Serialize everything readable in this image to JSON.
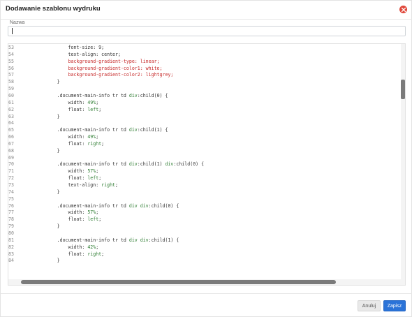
{
  "dialog": {
    "title": "Dodawanie szablonu wydruku",
    "close_icon": "close-icon",
    "close_color": "#e0473a"
  },
  "form": {
    "name_label": "Nazwa",
    "name_value": ""
  },
  "editor": {
    "lines": [
      {
        "n": "53",
        "segs": [
          {
            "t": "                font-size: 9;",
            "c": "plain"
          }
        ]
      },
      {
        "n": "54",
        "segs": [
          {
            "t": "                text-align: center;",
            "c": "plain"
          }
        ]
      },
      {
        "n": "55",
        "segs": [
          {
            "t": "                background-gradient-type: linear;",
            "c": "propc"
          }
        ]
      },
      {
        "n": "56",
        "segs": [
          {
            "t": "                background-gradient-color1: white;",
            "c": "propc"
          }
        ]
      },
      {
        "n": "57",
        "segs": [
          {
            "t": "                background-gradient-color2: lightgrey;",
            "c": "propc"
          }
        ]
      },
      {
        "n": "58",
        "segs": [
          {
            "t": "            }",
            "c": "plain"
          }
        ]
      },
      {
        "n": "59",
        "segs": [
          {
            "t": "",
            "c": "plain"
          }
        ]
      },
      {
        "n": "60",
        "segs": [
          {
            "t": "            .document-main-info tr td ",
            "c": "plain"
          },
          {
            "t": "div",
            "c": "val"
          },
          {
            "t": ":child(0) {",
            "c": "plain"
          }
        ]
      },
      {
        "n": "61",
        "segs": [
          {
            "t": "                width: ",
            "c": "plain"
          },
          {
            "t": "49%",
            "c": "val"
          },
          {
            "t": ";",
            "c": "plain"
          }
        ]
      },
      {
        "n": "62",
        "segs": [
          {
            "t": "                float: ",
            "c": "plain"
          },
          {
            "t": "left",
            "c": "val"
          },
          {
            "t": ";",
            "c": "plain"
          }
        ]
      },
      {
        "n": "63",
        "segs": [
          {
            "t": "            }",
            "c": "plain"
          }
        ]
      },
      {
        "n": "64",
        "segs": [
          {
            "t": "",
            "c": "plain"
          }
        ]
      },
      {
        "n": "65",
        "segs": [
          {
            "t": "            .document-main-info tr td ",
            "c": "plain"
          },
          {
            "t": "div",
            "c": "val"
          },
          {
            "t": ":child(1) {",
            "c": "plain"
          }
        ]
      },
      {
        "n": "66",
        "segs": [
          {
            "t": "                width: ",
            "c": "plain"
          },
          {
            "t": "49%",
            "c": "val"
          },
          {
            "t": ";",
            "c": "plain"
          }
        ]
      },
      {
        "n": "67",
        "segs": [
          {
            "t": "                float: ",
            "c": "plain"
          },
          {
            "t": "right",
            "c": "val"
          },
          {
            "t": ";",
            "c": "plain"
          }
        ]
      },
      {
        "n": "68",
        "segs": [
          {
            "t": "            }",
            "c": "plain"
          }
        ]
      },
      {
        "n": "69",
        "segs": [
          {
            "t": "",
            "c": "plain"
          }
        ]
      },
      {
        "n": "70",
        "segs": [
          {
            "t": "            .document-main-info tr td ",
            "c": "plain"
          },
          {
            "t": "div",
            "c": "val"
          },
          {
            "t": ":child(1) ",
            "c": "plain"
          },
          {
            "t": "div",
            "c": "val"
          },
          {
            "t": ":child(0) {",
            "c": "plain"
          }
        ]
      },
      {
        "n": "71",
        "segs": [
          {
            "t": "                width: ",
            "c": "plain"
          },
          {
            "t": "57%",
            "c": "val"
          },
          {
            "t": ";",
            "c": "plain"
          }
        ]
      },
      {
        "n": "72",
        "segs": [
          {
            "t": "                float: ",
            "c": "plain"
          },
          {
            "t": "left",
            "c": "val"
          },
          {
            "t": ";",
            "c": "plain"
          }
        ]
      },
      {
        "n": "73",
        "segs": [
          {
            "t": "                text-align: ",
            "c": "plain"
          },
          {
            "t": "right",
            "c": "val"
          },
          {
            "t": ";",
            "c": "plain"
          }
        ]
      },
      {
        "n": "74",
        "segs": [
          {
            "t": "            }",
            "c": "plain"
          }
        ]
      },
      {
        "n": "75",
        "segs": [
          {
            "t": "",
            "c": "plain"
          }
        ]
      },
      {
        "n": "76",
        "segs": [
          {
            "t": "            .document-main-info tr td ",
            "c": "plain"
          },
          {
            "t": "div div",
            "c": "val"
          },
          {
            "t": ":child(0) {",
            "c": "plain"
          }
        ]
      },
      {
        "n": "77",
        "segs": [
          {
            "t": "                width: ",
            "c": "plain"
          },
          {
            "t": "57%",
            "c": "val"
          },
          {
            "t": ";",
            "c": "plain"
          }
        ]
      },
      {
        "n": "78",
        "segs": [
          {
            "t": "                float: ",
            "c": "plain"
          },
          {
            "t": "left",
            "c": "val"
          },
          {
            "t": ";",
            "c": "plain"
          }
        ]
      },
      {
        "n": "79",
        "segs": [
          {
            "t": "            }",
            "c": "plain"
          }
        ]
      },
      {
        "n": "80",
        "segs": [
          {
            "t": "",
            "c": "plain"
          }
        ]
      },
      {
        "n": "81",
        "segs": [
          {
            "t": "            .document-main-info tr td ",
            "c": "plain"
          },
          {
            "t": "div div",
            "c": "val"
          },
          {
            "t": ":child(1) {",
            "c": "plain"
          }
        ]
      },
      {
        "n": "82",
        "segs": [
          {
            "t": "                width: ",
            "c": "plain"
          },
          {
            "t": "42%",
            "c": "val"
          },
          {
            "t": ";",
            "c": "plain"
          }
        ]
      },
      {
        "n": "83",
        "segs": [
          {
            "t": "                float: ",
            "c": "plain"
          },
          {
            "t": "right",
            "c": "val"
          },
          {
            "t": ";",
            "c": "plain"
          }
        ]
      },
      {
        "n": "84",
        "segs": [
          {
            "t": "            }",
            "c": "plain"
          }
        ]
      }
    ]
  },
  "footer": {
    "cancel_label": "Anuluj",
    "save_label": "Zapisz",
    "save_color": "#2b73d8"
  }
}
